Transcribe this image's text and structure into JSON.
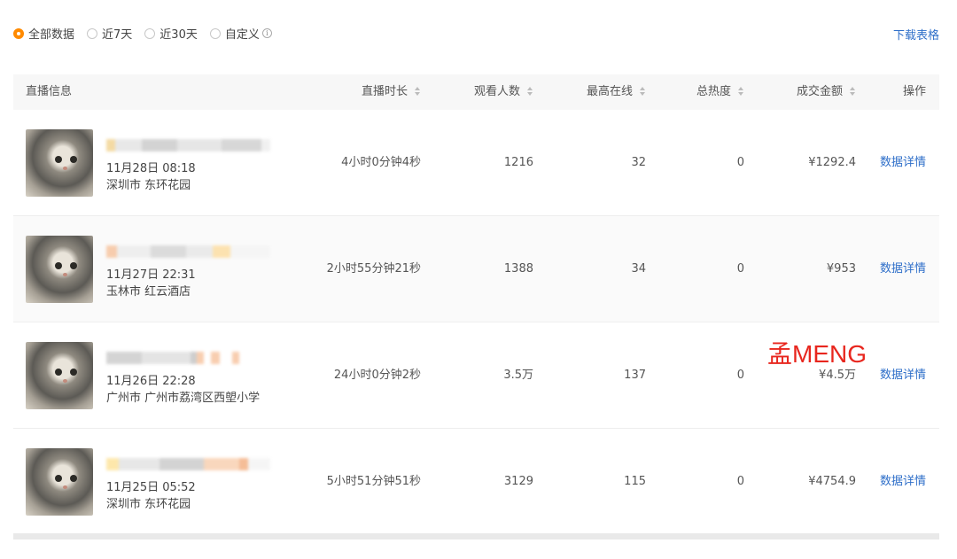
{
  "filters": {
    "options": [
      {
        "label": "全部数据",
        "selected": true
      },
      {
        "label": "近7天",
        "selected": false
      },
      {
        "label": "近30天",
        "selected": false
      },
      {
        "label": "自定义",
        "selected": false
      }
    ],
    "info_icon": "info-circle-icon"
  },
  "download_label": "下载表格",
  "table": {
    "headers": {
      "info": "直播信息",
      "duration": "直播时长",
      "viewers": "观看人数",
      "peak": "最高在线",
      "heat": "总热度",
      "amount": "成交金额",
      "action": "操作"
    },
    "rows": [
      {
        "date": "11月28日 08:18",
        "location": "深圳市 东环花园",
        "duration": "4小时0分钟4秒",
        "viewers": "1216",
        "peak": "32",
        "heat": "0",
        "amount": "¥1292.4",
        "action": "数据详情"
      },
      {
        "date": "11月27日 22:31",
        "location": "玉林市 红云酒店",
        "duration": "2小时55分钟21秒",
        "viewers": "1388",
        "peak": "34",
        "heat": "0",
        "amount": "¥953",
        "action": "数据详情"
      },
      {
        "date": "11月26日 22:28",
        "location": "广州市 广州市荔湾区西塱小学",
        "duration": "24小时0分钟2秒",
        "viewers": "3.5万",
        "peak": "137",
        "heat": "0",
        "amount": "¥4.5万",
        "action": "数据详情"
      },
      {
        "date": "11月25日 05:52",
        "location": "深圳市 东环花园",
        "duration": "5小时51分钟51秒",
        "viewers": "3129",
        "peak": "115",
        "heat": "0",
        "amount": "¥4754.9",
        "action": "数据详情"
      }
    ]
  },
  "watermark": "孟MENG",
  "colors": {
    "accent": "#ff8a00",
    "link": "#2f6fc9",
    "watermark": "#e8261e"
  }
}
